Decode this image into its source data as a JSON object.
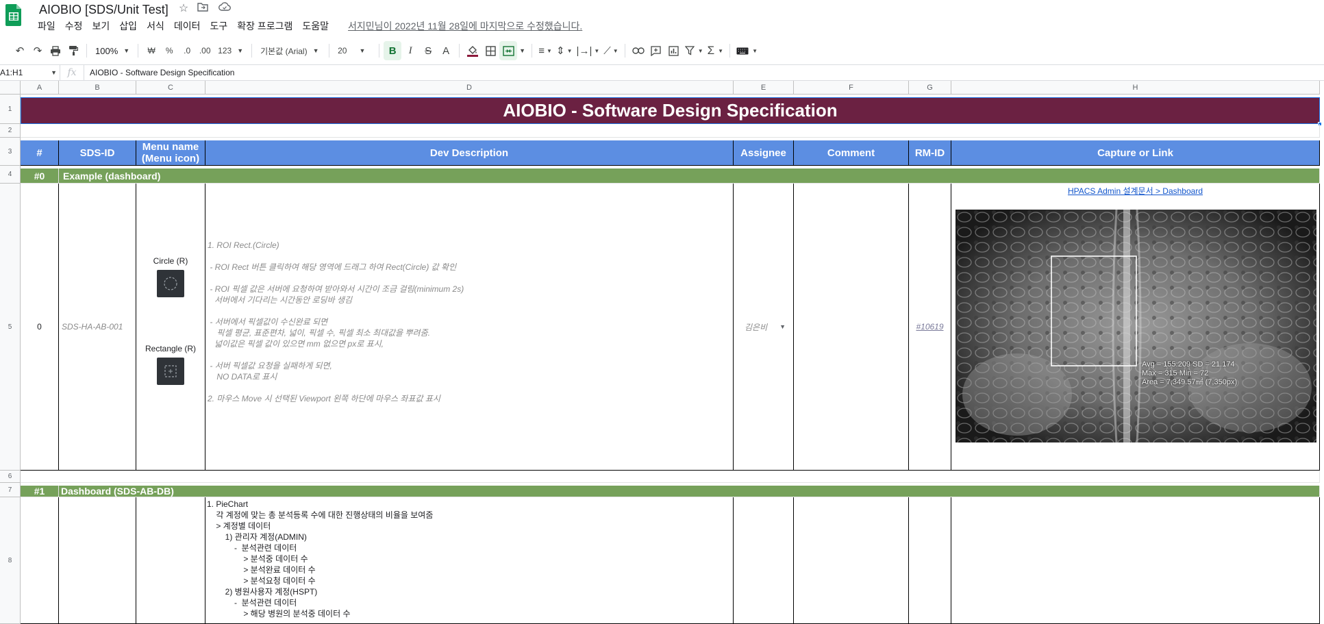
{
  "app": {
    "doc_title": "AIOBIO [SDS/Unit Test]",
    "last_edit": "서지민님이 2022년 11월 28일에 마지막으로 수정했습니다.",
    "menu": [
      "파일",
      "수정",
      "보기",
      "삽입",
      "서식",
      "데이터",
      "도구",
      "확장 프로그램",
      "도움말"
    ],
    "brand_color": "#0f9d58"
  },
  "toolbar": {
    "zoom": "100%",
    "currency": "₩",
    "percent": "%",
    "dec_decrease": ".0",
    "dec_increase": ".00",
    "number_format": "123",
    "font_family": "기본값 (Arial)",
    "font_size": "20",
    "bold": "B",
    "italic": "I",
    "strike": "S",
    "text_color": "A"
  },
  "formula_bar": {
    "cell_ref": "A1:H1",
    "fx": "fx",
    "value": "AIOBIO - Software Design Specification"
  },
  "columns": [
    "A",
    "B",
    "C",
    "D",
    "E",
    "F",
    "G",
    "H"
  ],
  "rows": [
    "1",
    "2",
    "3",
    "4",
    "5",
    "6",
    "7",
    "8"
  ],
  "sheet": {
    "banner": "AIOBIO - Software Design Specification",
    "headers": {
      "num": "#",
      "sds_id": "SDS-ID",
      "menu_name": "Menu name\n(Menu icon)",
      "dev_desc": "Dev Description",
      "assignee": "Assignee",
      "comment": "Comment",
      "rm_id": "RM-ID",
      "capture": "Capture or Link"
    },
    "section0": {
      "num": "#0",
      "title": "Example  (dashboard)"
    },
    "row5": {
      "num": "0",
      "sds_id": "SDS-HA-AB-001",
      "menu_circle": "Circle (R)",
      "menu_rect": "Rectangle (R)",
      "description": [
        "1. ROI Rect.(Circle)",
        "",
        " - ROI Rect 버튼 클릭하여 해당 영역에 드래그 하여 Rect(Circle) 값 확인",
        "",
        " - ROI 픽셀 값은 서버에 요청하여 받아와서 시간이 조금 걸림(minimum 2s)",
        "   서버에서 기다리는 시간동안 로딩바 생김",
        "",
        " - 서버에서 픽셀값이 수신완료 되면",
        "    픽셀 평균, 표준편차, 넓이, 픽셀 수, 픽셀 최소 최대값을 뿌려줌.",
        "   넓이값은 픽셀 값이 있으면 mm 없으면 px로 표시,",
        "",
        " - 서버 픽셀값 요청을 실패하게 되면,",
        "    NO DATA로 표시",
        "",
        "2. 마우스 Move 시 선택된 Viewport 왼쪽 하단에 마우스 좌표값 표시"
      ],
      "assignee": "김은비",
      "rm_id": "#10619",
      "capture_link": "HPACS Admin 설계문서 > Dashboard",
      "roi_stats": [
        "Avg = 155.209 SD = 21.174",
        "Max = 315 Min = 72",
        "Area = 7,349.57㎟ (7,350px)"
      ]
    },
    "section1": {
      "num": "#1",
      "title": "Dashboard (SDS-AB-DB)"
    },
    "row8": {
      "description": [
        "1. PieChart",
        "    각 계정에 맞는 총 분석등록 수에 대한 진행상태의 비율을 보여줌",
        "    > 계정별 데이터",
        "        1) 관리자 계정(ADMIN)",
        "            -  분석관련 데이터",
        "                > 분석중 데이터 수",
        "                > 분석완료 데이터 수",
        "                > 분석요청 데이터 수",
        "        2) 병원사용자 계정(HSPT)",
        "            -  분석관련 데이터",
        "                > 해당 병원의 분석중 데이터 수"
      ]
    }
  },
  "colors": {
    "banner": "#6b2142",
    "header": "#5c8ee2",
    "section": "#76a15a",
    "link": "#1155cc"
  }
}
